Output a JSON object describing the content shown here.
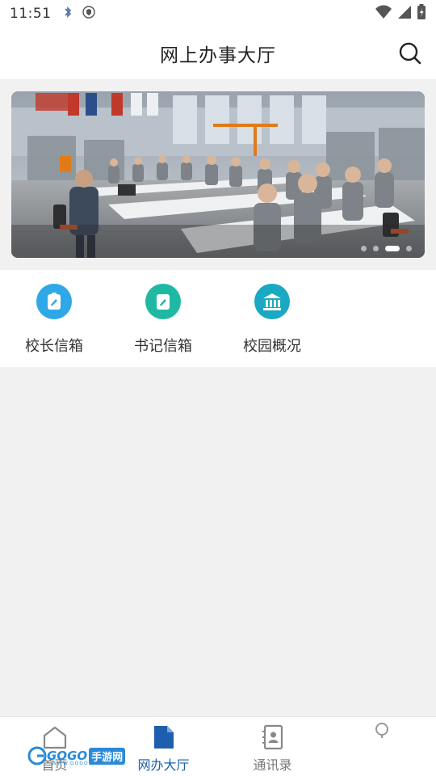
{
  "status_bar": {
    "time": "11:51"
  },
  "header": {
    "title": "网上办事大厅"
  },
  "banner": {
    "slide_count": 4,
    "active_slide_index": 2
  },
  "quick_menu": [
    {
      "label": "校长信箱",
      "icon": "edit-icon",
      "color": "#2ea8e6"
    },
    {
      "label": "书记信箱",
      "icon": "edit-icon",
      "color": "#1fb9a3"
    },
    {
      "label": "校园概况",
      "icon": "building-icon",
      "color": "#1aa8c2"
    }
  ],
  "bottom_nav": [
    {
      "label": "首页",
      "icon": "home-icon",
      "active": false
    },
    {
      "label": "网办大厅",
      "icon": "document-icon",
      "active": true
    },
    {
      "label": "通讯录",
      "icon": "contacts-icon",
      "active": false
    },
    {
      "label": "",
      "icon": "profile-icon",
      "active": false
    }
  ],
  "watermark": {
    "text": "GOGO",
    "text2": "手游网",
    "sub": "WWW.GOGOD.CN"
  },
  "colors": {
    "active_nav": "#1d5fae",
    "background": "#f1f1f1"
  }
}
